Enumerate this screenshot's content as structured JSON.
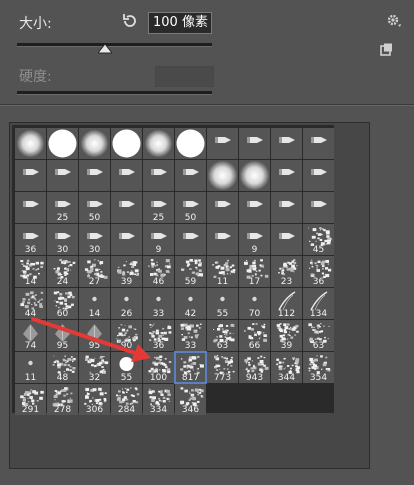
{
  "header": {
    "size_label": "大小:",
    "size_value": "100 像素",
    "size_slider_percent": 45,
    "hardness_label": "硬度:",
    "hardness_slider_percent": 0
  },
  "colors": {
    "panel_bg": "#535353",
    "well_bg": "#474747",
    "grid_bg": "#2a2a2a",
    "cell_bg": "#555555",
    "selection": "#5a7fc2",
    "arrow": "#e53935"
  },
  "brushes": {
    "columns": 10,
    "selected_index": 75,
    "items": [
      {
        "type": "soft-round",
        "label": ""
      },
      {
        "type": "hard-round",
        "label": ""
      },
      {
        "type": "soft-round",
        "label": ""
      },
      {
        "type": "hard-round",
        "label": ""
      },
      {
        "type": "soft-round",
        "label": ""
      },
      {
        "type": "hard-round",
        "label": ""
      },
      {
        "type": "tip",
        "label": ""
      },
      {
        "type": "tip",
        "label": ""
      },
      {
        "type": "tip",
        "label": ""
      },
      {
        "type": "tip",
        "label": ""
      },
      {
        "type": "tip",
        "label": ""
      },
      {
        "type": "tip",
        "label": ""
      },
      {
        "type": "tip",
        "label": ""
      },
      {
        "type": "tip",
        "label": ""
      },
      {
        "type": "tip",
        "label": ""
      },
      {
        "type": "tip",
        "label": ""
      },
      {
        "type": "soft-round-big",
        "label": ""
      },
      {
        "type": "soft-round-big",
        "label": ""
      },
      {
        "type": "tip",
        "label": ""
      },
      {
        "type": "tip",
        "label": ""
      },
      {
        "type": "tip",
        "label": ""
      },
      {
        "type": "tip",
        "label": "25"
      },
      {
        "type": "tip",
        "label": "50"
      },
      {
        "type": "tip",
        "label": ""
      },
      {
        "type": "tip",
        "label": "25"
      },
      {
        "type": "tip",
        "label": "50"
      },
      {
        "type": "tip",
        "label": ""
      },
      {
        "type": "tip",
        "label": ""
      },
      {
        "type": "tip",
        "label": ""
      },
      {
        "type": "tip",
        "label": ""
      },
      {
        "type": "tip",
        "label": "36"
      },
      {
        "type": "tip",
        "label": "30"
      },
      {
        "type": "tip",
        "label": "30"
      },
      {
        "type": "tip",
        "label": ""
      },
      {
        "type": "tip",
        "label": "9"
      },
      {
        "type": "tip",
        "label": ""
      },
      {
        "type": "tip",
        "label": ""
      },
      {
        "type": "tip",
        "label": "9"
      },
      {
        "type": "tip",
        "label": ""
      },
      {
        "type": "texture",
        "label": "45"
      },
      {
        "type": "texture",
        "label": "14"
      },
      {
        "type": "texture",
        "label": "24"
      },
      {
        "type": "texture",
        "label": "27"
      },
      {
        "type": "texture",
        "label": "39"
      },
      {
        "type": "texture",
        "label": "46"
      },
      {
        "type": "texture",
        "label": "59"
      },
      {
        "type": "texture",
        "label": "11"
      },
      {
        "type": "texture",
        "label": "17"
      },
      {
        "type": "texture",
        "label": "23"
      },
      {
        "type": "texture",
        "label": "36"
      },
      {
        "type": "texture",
        "label": "44"
      },
      {
        "type": "texture",
        "label": "60"
      },
      {
        "type": "dot",
        "label": "14"
      },
      {
        "type": "dot",
        "label": "26"
      },
      {
        "type": "dot",
        "label": "33"
      },
      {
        "type": "dot",
        "label": "42"
      },
      {
        "type": "dot",
        "label": "55"
      },
      {
        "type": "dot",
        "label": "70"
      },
      {
        "type": "stroke",
        "label": "112"
      },
      {
        "type": "stroke",
        "label": "134"
      },
      {
        "type": "leaf",
        "label": "74"
      },
      {
        "type": "leaf",
        "label": "95"
      },
      {
        "type": "leaf",
        "label": "95"
      },
      {
        "type": "texture",
        "label": "90"
      },
      {
        "type": "texture",
        "label": "36"
      },
      {
        "type": "texture",
        "label": "33"
      },
      {
        "type": "texture",
        "label": "63"
      },
      {
        "type": "texture",
        "label": "66"
      },
      {
        "type": "texture",
        "label": "39"
      },
      {
        "type": "texture",
        "label": "63"
      },
      {
        "type": "dot",
        "label": "11"
      },
      {
        "type": "texture",
        "label": "48"
      },
      {
        "type": "texture",
        "label": "32"
      },
      {
        "type": "hard-round-sm",
        "label": "55"
      },
      {
        "type": "texture",
        "label": "100"
      },
      {
        "type": "texture",
        "label": "817"
      },
      {
        "type": "texture",
        "label": "773"
      },
      {
        "type": "texture",
        "label": "943"
      },
      {
        "type": "texture",
        "label": "344"
      },
      {
        "type": "texture",
        "label": "354"
      },
      {
        "type": "texture",
        "label": "291"
      },
      {
        "type": "texture",
        "label": "278"
      },
      {
        "type": "texture",
        "label": "306"
      },
      {
        "type": "texture",
        "label": "284"
      },
      {
        "type": "texture",
        "label": "334"
      },
      {
        "type": "texture",
        "label": "346"
      }
    ]
  }
}
